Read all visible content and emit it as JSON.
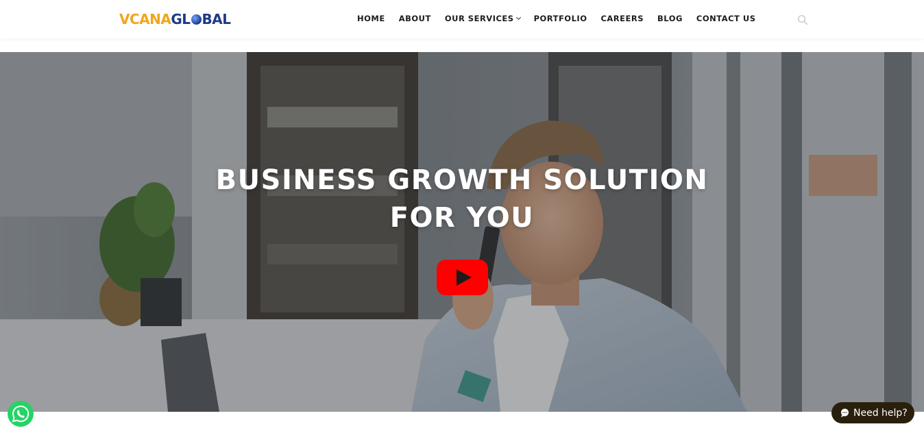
{
  "header": {
    "logo": {
      "part1": "VCANA",
      "part2_a": "GL",
      "part2_b": "BAL"
    },
    "nav": [
      {
        "label": "HOME"
      },
      {
        "label": "ABOUT"
      },
      {
        "label": "OUR SERVICES",
        "has_dropdown": true
      },
      {
        "label": "PORTFOLIO"
      },
      {
        "label": "CAREERS"
      },
      {
        "label": "BLOG"
      },
      {
        "label": "CONTACT US"
      }
    ],
    "search_icon": "search-icon"
  },
  "hero": {
    "title_line1": "BUSINESS GROWTH SOLUTION",
    "title_line2": "FOR YOU",
    "play_icon": "youtube-play-icon",
    "play_color": "#ff0000"
  },
  "floating": {
    "whatsapp_icon": "whatsapp-icon",
    "whatsapp_color": "#25d366",
    "help_label": "Need help?",
    "help_icon": "chat-bubble-icon"
  },
  "colors": {
    "brand_orange": "#f2a51a",
    "brand_blue": "#1d3a8a",
    "help_bg": "#2a1f0d"
  }
}
